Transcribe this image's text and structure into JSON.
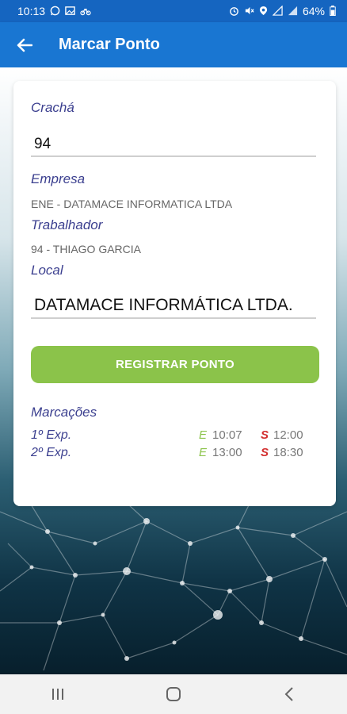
{
  "status_bar": {
    "time": "10:13",
    "battery": "64%",
    "left_icons": [
      "whatsapp-icon",
      "image-icon",
      "bike-icon"
    ],
    "right_icons": [
      "alarm-icon",
      "mute-icon",
      "location-icon",
      "signal-icon",
      "signal-icon",
      "battery-icon"
    ]
  },
  "app_bar": {
    "title": "Marcar Ponto",
    "back_icon": "arrow-left-icon"
  },
  "form": {
    "cracha_label": "Crachá",
    "cracha_value": "94",
    "empresa_label": "Empresa",
    "empresa_value": "ENE - DATAMACE INFORMATICA LTDA",
    "trabalhador_label": "Trabalhador",
    "trabalhador_value": "94 - THIAGO GARCIA",
    "local_label": "Local",
    "local_value": "DATAMACE INFORMÁTICA LTDA.",
    "register_button": "REGISTRAR PONTO"
  },
  "marcacoes": {
    "title": "Marcações",
    "rows": [
      {
        "label": "1º Exp.",
        "entry_tag": "E",
        "entry_time": "10:07",
        "exit_tag": "S",
        "exit_time": "12:00"
      },
      {
        "label": "2º Exp.",
        "entry_tag": "E",
        "entry_time": "13:00",
        "exit_tag": "S",
        "exit_time": "18:30"
      }
    ]
  },
  "colors": {
    "primary": "#1976d2",
    "status_bar": "#1565c0",
    "accent_green": "#8bc34a",
    "exit_red": "#d32f2f",
    "label_indigo": "#3b3f8f"
  },
  "nav_bar": {
    "icons": [
      "recent-apps-icon",
      "home-icon",
      "back-icon"
    ]
  }
}
